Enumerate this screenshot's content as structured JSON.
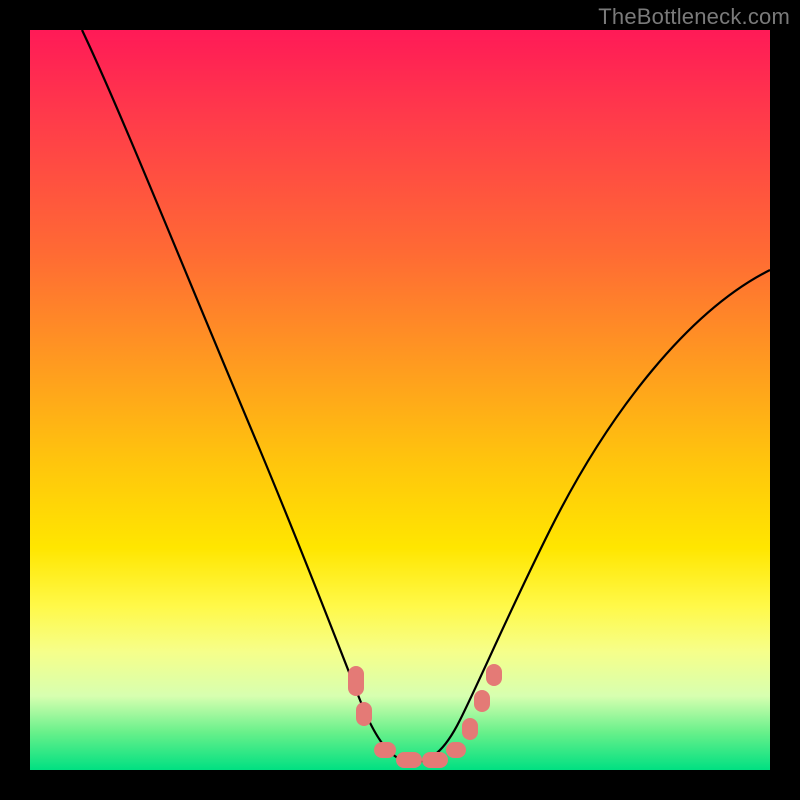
{
  "watermark": "TheBottleneck.com",
  "chart_data": {
    "type": "line",
    "title": "",
    "xlabel": "",
    "ylabel": "",
    "xlim": [
      0,
      100
    ],
    "ylim": [
      0,
      100
    ],
    "series": [
      {
        "name": "curve",
        "x": [
          7,
          12,
          18,
          24,
          30,
          36,
          41,
          44,
          47,
          50,
          53,
          56,
          60,
          65,
          72,
          80,
          90,
          100
        ],
        "y": [
          100,
          88,
          74,
          60,
          46,
          32,
          20,
          12,
          6,
          2,
          2,
          4,
          9,
          17,
          28,
          40,
          54,
          67
        ]
      }
    ],
    "markers": [
      {
        "x": 44.0,
        "y": 12.0
      },
      {
        "x": 45.0,
        "y": 9.0
      },
      {
        "x": 47.5,
        "y": 3.0
      },
      {
        "x": 50.0,
        "y": 2.0
      },
      {
        "x": 52.5,
        "y": 2.0
      },
      {
        "x": 55.0,
        "y": 2.5
      },
      {
        "x": 58.0,
        "y": 6.0
      },
      {
        "x": 60.0,
        "y": 9.5
      },
      {
        "x": 62.0,
        "y": 13.0
      }
    ],
    "gradient_note": "background encodes bottleneck percentage by vertical position: top=red (high), bottom=green (low)"
  }
}
